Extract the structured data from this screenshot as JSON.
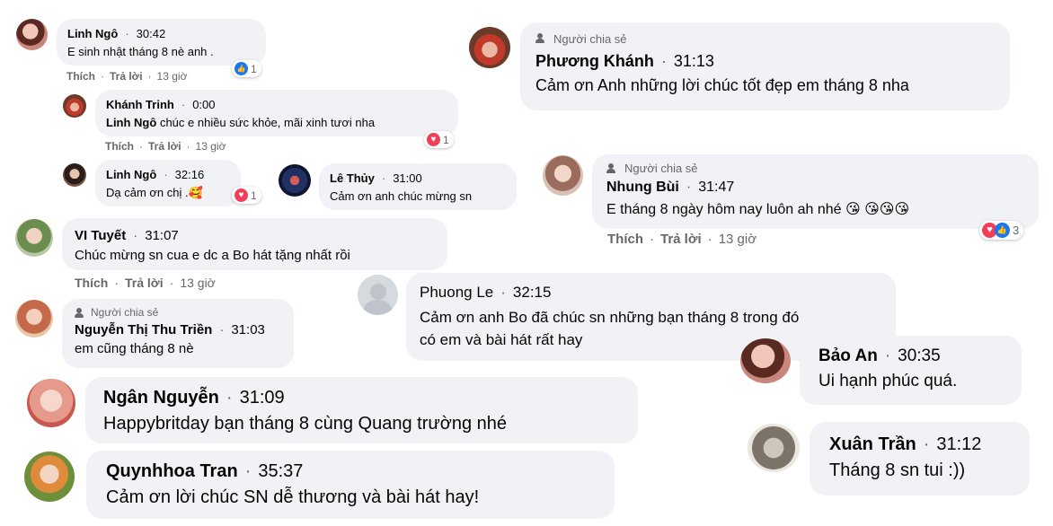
{
  "comments": [
    {
      "id": "linh1",
      "name": "Linh Ngô",
      "time": "30:42",
      "text": "E sinh nhật tháng 8 nè anh .",
      "reaction_count": "1"
    },
    {
      "id": "khanh",
      "name": "Khánh Trinh",
      "time": "0:00",
      "tag": "Linh Ngô",
      "text": " chúc e nhiều sức khỏe, mãi xinh tươi nha",
      "reaction_count": "1"
    },
    {
      "id": "linh2",
      "name": "Linh Ngô",
      "time": "32:16",
      "text": "Dạ cảm ơn chị .🥰",
      "reaction_count": "1"
    },
    {
      "id": "lethuy",
      "name": "Lê Thủy",
      "time": "31:00",
      "text": "Cảm ơn anh chúc mừng sn"
    },
    {
      "id": "vituyet",
      "name": "VI Tuyết",
      "time": "31:07",
      "text": "Chúc mừng sn cua e dc a Bo hát tặng nhất rồi"
    },
    {
      "id": "thutrien",
      "name": "Nguyễn Thị Thu Triền",
      "time": "31:03",
      "text": "em cũng tháng 8 nè",
      "sharer": "Người chia sẻ"
    },
    {
      "id": "ngan",
      "name": "Ngân Nguyễn",
      "time": "31:09",
      "text": "Happybritday bạn tháng 8 cùng Quang trường nhé"
    },
    {
      "id": "quynhhoa",
      "name": "Quynhhoa Tran",
      "time": "35:37",
      "text": "Cảm ơn lời chúc SN dễ thương và bài hát hay!"
    },
    {
      "id": "phuongkhanh",
      "name": "Phương Khánh",
      "time": "31:13",
      "text": "Cảm ơn Anh những lời chúc tốt đẹp em tháng 8 nha",
      "sharer": "Người chia sẻ"
    },
    {
      "id": "nhung",
      "name": "Nhung Bùi",
      "time": "31:47",
      "text": "E tháng 8 ngày hôm nay luôn ah nhé 😘 😘😘😘",
      "sharer": "Người chia sẻ",
      "reaction_count": "3"
    },
    {
      "id": "phuongle",
      "name": "Phuong Le",
      "time": "32:15",
      "text1": "Cảm ơn anh Bo đã chúc sn những bạn tháng 8 trong đó",
      "text2": "có em và bài hát rất hay"
    },
    {
      "id": "baoan",
      "name": "Bảo An",
      "time": "30:35",
      "text": "Ui hạnh phúc quá."
    },
    {
      "id": "xuan",
      "name": "Xuân Trần",
      "time": "31:12",
      "text": "Tháng 8 sn tui :))"
    }
  ],
  "actions": {
    "like": "Thích",
    "reply": "Trả lời",
    "ago": "13 giờ"
  },
  "colors": {
    "bubble": "#f0f2f5",
    "muted": "#65676b",
    "like": "#1877f2",
    "love": "#f33e58"
  }
}
